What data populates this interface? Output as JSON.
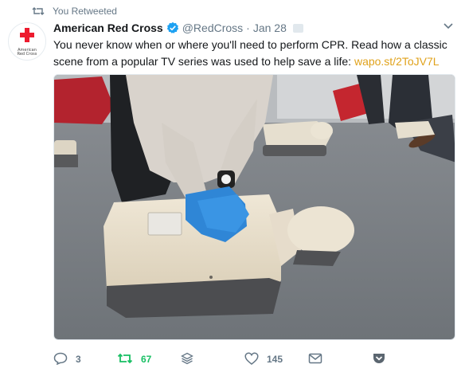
{
  "context": {
    "text": "You Retweeted",
    "icon": "retweet-icon"
  },
  "author": {
    "display_name": "American Red Cross",
    "handle": "@RedCross",
    "separator": "·",
    "date": "Jan 28",
    "verified": true,
    "avatar_text_line1": "American",
    "avatar_text_line2": "Red Cross",
    "brand_color": "#ed1b2e"
  },
  "tweet": {
    "text": "You never know when or where you'll need to perform CPR. Read how a classic scene from a popular TV series was used to help save a life: ",
    "link_text": "wapo.st/2ToJV7L",
    "link_color": "#e0a21b"
  },
  "actions": {
    "reply_count": "3",
    "retweet_count": "67",
    "like_count": "145",
    "retweet_color": "#17bf63",
    "muted_color": "#657786"
  }
}
